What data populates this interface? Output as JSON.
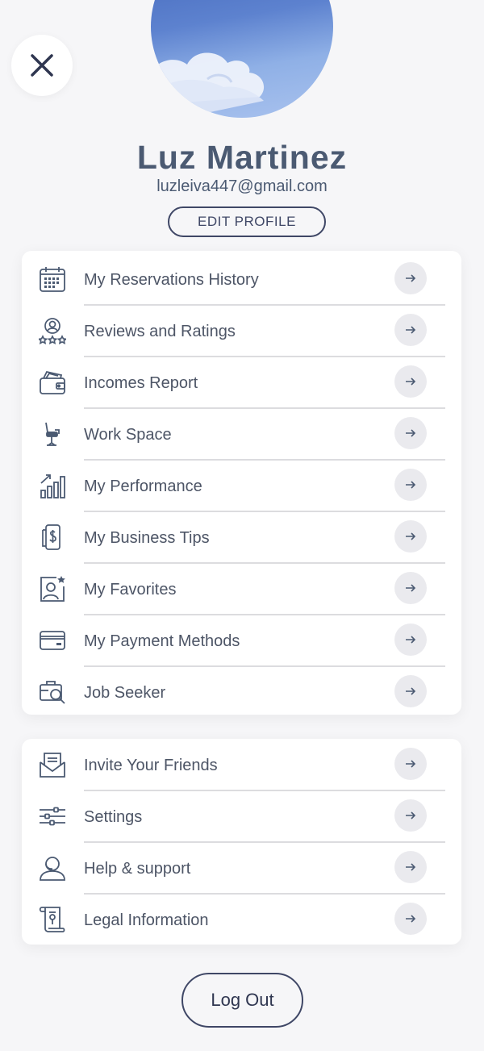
{
  "header": {
    "close_icon": "close-icon",
    "name": "Luz Martinez",
    "email": "luzleiva447@gmail.com",
    "edit_label": "EDIT PROFILE"
  },
  "menu_primary": [
    {
      "label": "My Reservations History",
      "icon": "calendar-icon"
    },
    {
      "label": "Reviews and Ratings",
      "icon": "user-rating-icon"
    },
    {
      "label": "Incomes Report",
      "icon": "wallet-icon"
    },
    {
      "label": "Work Space",
      "icon": "salon-chair-icon"
    },
    {
      "label": "My Performance",
      "icon": "growth-chart-icon"
    },
    {
      "label": "My Business Tips",
      "icon": "money-tips-icon"
    },
    {
      "label": "My Favorites",
      "icon": "favorite-profile-icon"
    },
    {
      "label": "My Payment Methods",
      "icon": "credit-card-icon"
    },
    {
      "label": "Job Seeker",
      "icon": "job-search-icon"
    }
  ],
  "menu_secondary": [
    {
      "label": "Invite Your Friends",
      "icon": "envelope-icon"
    },
    {
      "label": "Settings",
      "icon": "sliders-icon"
    },
    {
      "label": "Help & support",
      "icon": "support-agent-icon"
    },
    {
      "label": "Legal Information",
      "icon": "legal-scroll-icon"
    }
  ],
  "logout_label": "Log Out",
  "colors": {
    "background": "#f6f6f8",
    "text": "#4b5a72",
    "border": "#3f4766",
    "arrow_bg": "#eaeaee"
  }
}
